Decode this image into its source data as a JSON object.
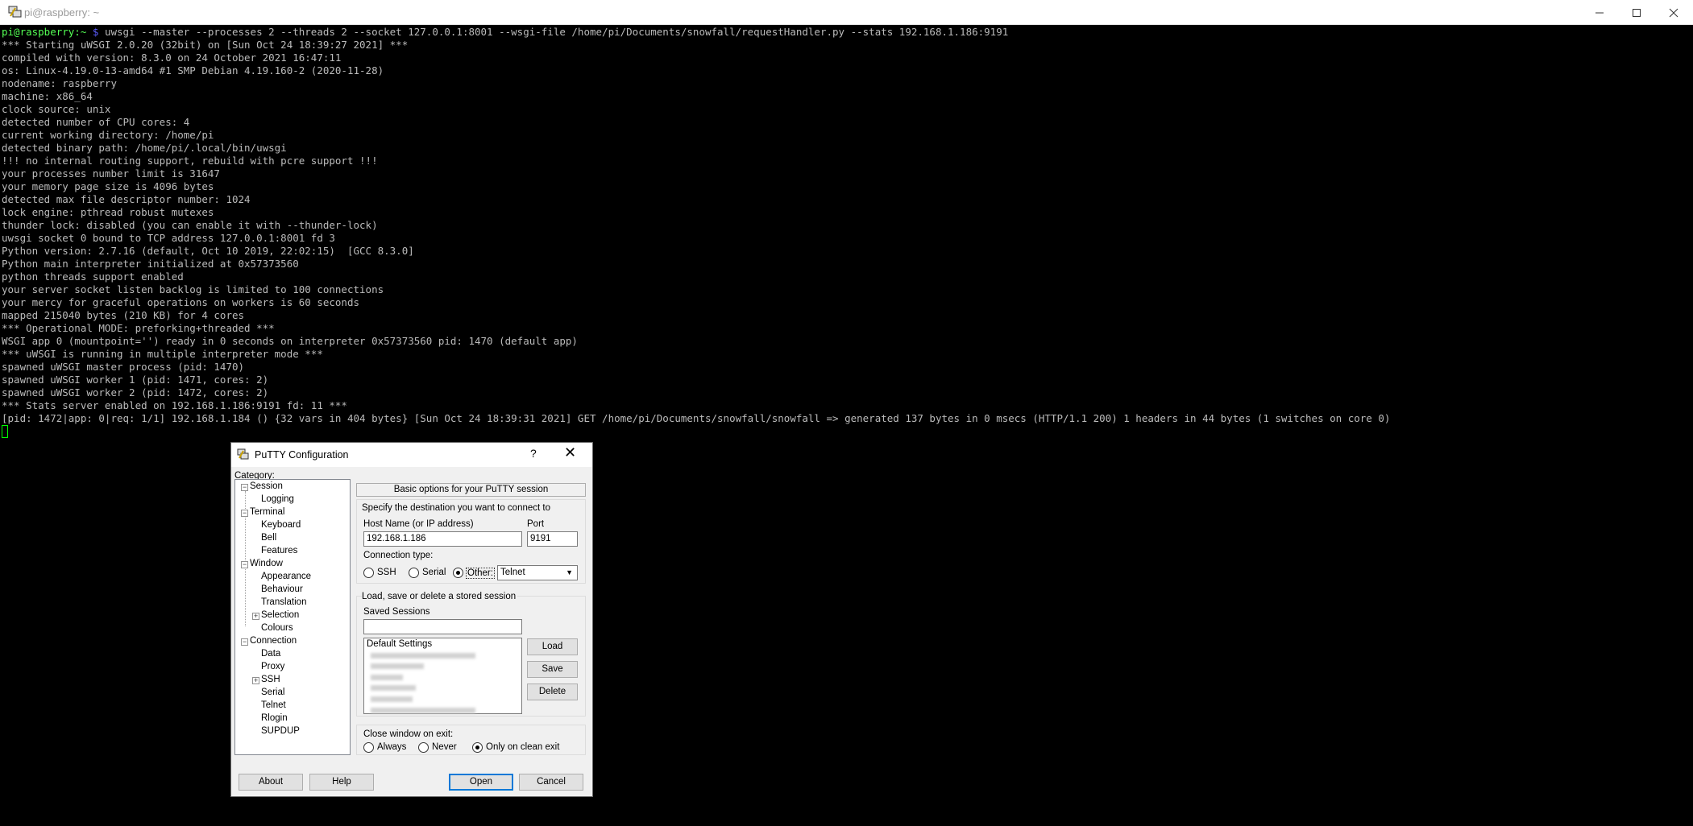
{
  "window": {
    "title": "pi@raspberry: ~",
    "minimize_icon": "minimize-icon",
    "maximize_icon": "maximize-icon",
    "close_icon": "close-icon"
  },
  "terminal": {
    "prompt_user": "pi@raspberry:~",
    "prompt_symbol": " $ ",
    "command": "uwsgi --master --processes 2 --threads 2 --socket 127.0.0.1:8001 --wsgi-file /home/pi/Documents/snowfall/requestHandler.py --stats 192.168.1.186:9191",
    "lines": [
      "*** Starting uWSGI 2.0.20 (32bit) on [Sun Oct 24 18:39:27 2021] ***",
      "compiled with version: 8.3.0 on 24 October 2021 16:47:11",
      "os: Linux-4.19.0-13-amd64 #1 SMP Debian 4.19.160-2 (2020-11-28)",
      "nodename: raspberry",
      "machine: x86_64",
      "clock source: unix",
      "detected number of CPU cores: 4",
      "current working directory: /home/pi",
      "detected binary path: /home/pi/.local/bin/uwsgi",
      "!!! no internal routing support, rebuild with pcre support !!!",
      "your processes number limit is 31647",
      "your memory page size is 4096 bytes",
      "detected max file descriptor number: 1024",
      "lock engine: pthread robust mutexes",
      "thunder lock: disabled (you can enable it with --thunder-lock)",
      "uwsgi socket 0 bound to TCP address 127.0.0.1:8001 fd 3",
      "Python version: 2.7.16 (default, Oct 10 2019, 22:02:15)  [GCC 8.3.0]",
      "Python main interpreter initialized at 0x57373560",
      "python threads support enabled",
      "your server socket listen backlog is limited to 100 connections",
      "your mercy for graceful operations on workers is 60 seconds",
      "mapped 215040 bytes (210 KB) for 4 cores",
      "*** Operational MODE: preforking+threaded ***",
      "WSGI app 0 (mountpoint='') ready in 0 seconds on interpreter 0x57373560 pid: 1470 (default app)",
      "*** uWSGI is running in multiple interpreter mode ***",
      "spawned uWSGI master process (pid: 1470)",
      "spawned uWSGI worker 1 (pid: 1471, cores: 2)",
      "spawned uWSGI worker 2 (pid: 1472, cores: 2)",
      "*** Stats server enabled on 192.168.1.186:9191 fd: 11 ***",
      "[pid: 1472|app: 0|req: 1/1] 192.168.1.184 () {32 vars in 404 bytes} [Sun Oct 24 18:39:31 2021] GET /home/pi/Documents/snowfall/snowfall => generated 137 bytes in 0 msecs (HTTP/1.1 200) 1 headers in 44 bytes (1 switches on core 0)"
    ]
  },
  "putty": {
    "title": "PuTTY Configuration",
    "help_label": "?",
    "close_label": "✕",
    "category_label": "Category:",
    "tree": [
      {
        "label": "Session",
        "level": 0,
        "expander": "⊟"
      },
      {
        "label": "Logging",
        "level": 1
      },
      {
        "label": "Terminal",
        "level": 0,
        "expander": "⊟"
      },
      {
        "label": "Keyboard",
        "level": 1
      },
      {
        "label": "Bell",
        "level": 1
      },
      {
        "label": "Features",
        "level": 1
      },
      {
        "label": "Window",
        "level": 0,
        "expander": "⊟"
      },
      {
        "label": "Appearance",
        "level": 1
      },
      {
        "label": "Behaviour",
        "level": 1
      },
      {
        "label": "Translation",
        "level": 1
      },
      {
        "label": "Selection",
        "level": 1,
        "expander": "⊞"
      },
      {
        "label": "Colours",
        "level": 1
      },
      {
        "label": "Connection",
        "level": 0,
        "expander": "⊟"
      },
      {
        "label": "Data",
        "level": 1
      },
      {
        "label": "Proxy",
        "level": 1
      },
      {
        "label": "SSH",
        "level": 1,
        "expander": "⊞"
      },
      {
        "label": "Serial",
        "level": 1
      },
      {
        "label": "Telnet",
        "level": 1
      },
      {
        "label": "Rlogin",
        "level": 1
      },
      {
        "label": "SUPDUP",
        "level": 1
      }
    ],
    "header_button": "Basic options for your PuTTY session",
    "destination_label": "Specify the destination you want to connect to",
    "host_label": "Host Name (or IP address)",
    "host_value": "192.168.1.186",
    "port_label": "Port",
    "port_value": "9191",
    "connection_type_label": "Connection type:",
    "conn_ssh": "SSH",
    "conn_serial": "Serial",
    "conn_other": "Other:",
    "conn_selected": "Other",
    "protocol_value": "Telnet",
    "sessions_group_label": "Load, save or delete a stored session",
    "saved_sessions_label": "Saved Sessions",
    "saved_sessions_value": "",
    "session_first": "Default Settings",
    "load_label": "Load",
    "save_label": "Save",
    "delete_label": "Delete",
    "close_window_label": "Close window on exit:",
    "close_always": "Always",
    "close_never": "Never",
    "close_clean": "Only on clean exit",
    "close_selected": "Only on clean exit",
    "about_label": "About",
    "help_button_label": "Help",
    "open_label": "Open",
    "cancel_label": "Cancel"
  }
}
